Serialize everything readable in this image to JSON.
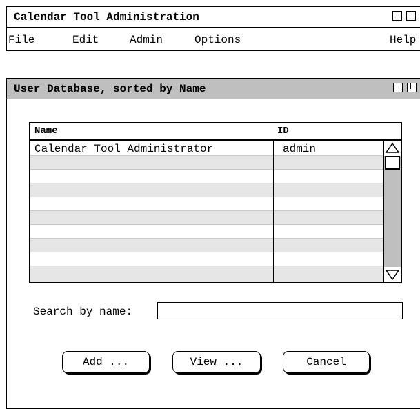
{
  "main_window": {
    "title": "Calendar Tool Administration",
    "menu": [
      "File",
      "Edit",
      "Admin",
      "Options",
      "Help"
    ]
  },
  "dialog": {
    "title": "User Database, sorted by Name",
    "table": {
      "columns": [
        "Name",
        "ID"
      ],
      "rows": [
        {
          "name": "Calendar Tool Administrator",
          "id": "admin"
        }
      ]
    },
    "search": {
      "label": "Search by name:",
      "value": ""
    },
    "buttons": {
      "add": "Add ...",
      "view": "View ...",
      "cancel": "Cancel"
    }
  }
}
